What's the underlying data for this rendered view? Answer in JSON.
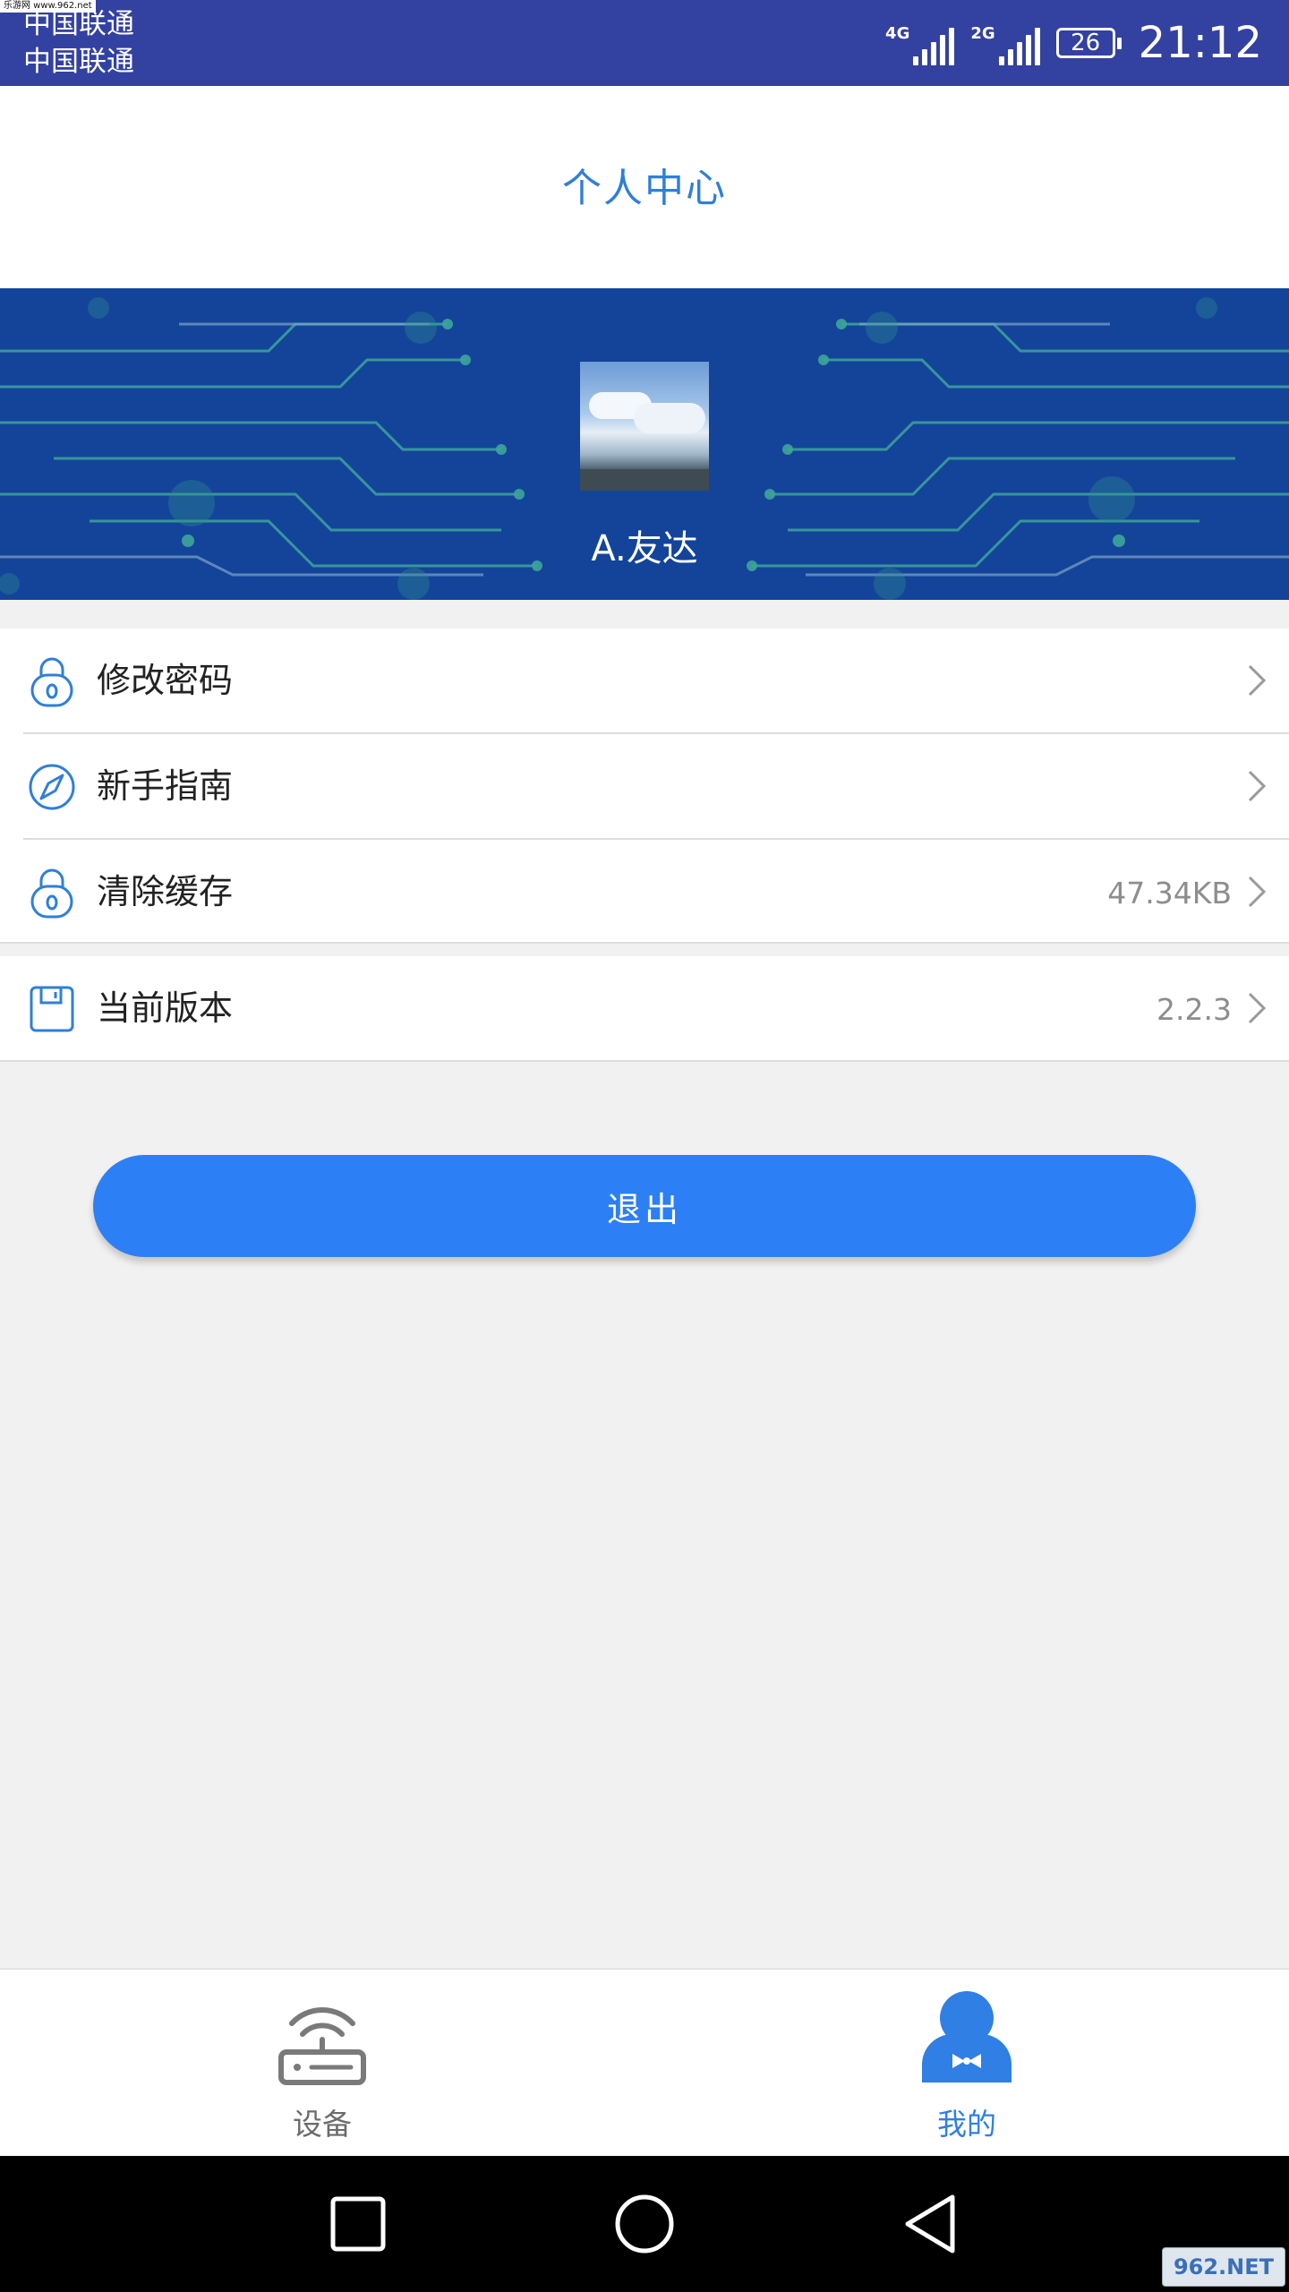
{
  "status_bar": {
    "watermark": "乐游网 www.962.net",
    "carrier_1": "中国联通",
    "carrier_2": "中国联通",
    "network_1": "4G",
    "network_2": "2G",
    "battery": "26",
    "time": "21:12"
  },
  "header": {
    "title": "个人中心"
  },
  "profile": {
    "username": "A.友达",
    "avatar_icon": "landscape-photo"
  },
  "menu": {
    "items": [
      {
        "label": "修改密码",
        "icon": "lock-icon",
        "value": ""
      },
      {
        "label": "新手指南",
        "icon": "compass-icon",
        "value": ""
      },
      {
        "label": "清除缓存",
        "icon": "lock-icon",
        "value": "47.34KB"
      },
      {
        "label": "当前版本",
        "icon": "save-icon",
        "value": "2.2.3"
      }
    ]
  },
  "logout": {
    "label": "退出"
  },
  "tabbar": {
    "tabs": [
      {
        "label": "设备",
        "icon": "router-icon",
        "active": false
      },
      {
        "label": "我的",
        "icon": "user-icon",
        "active": true
      }
    ]
  },
  "navbar": {
    "watermark": "962.NET"
  },
  "colors": {
    "status_bar": "#3341a1",
    "accent": "#2d7ff5",
    "title": "#2f7fd8",
    "banner": "#13449a"
  }
}
